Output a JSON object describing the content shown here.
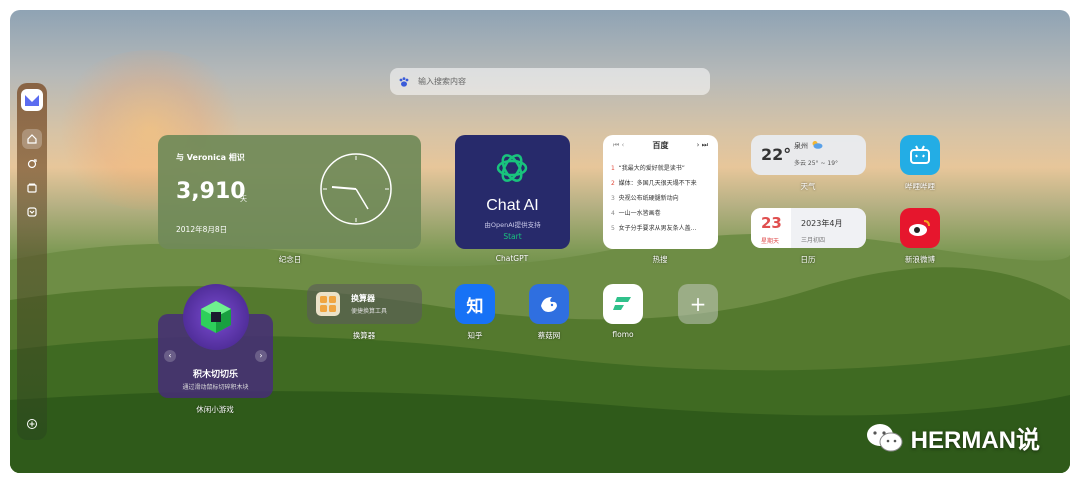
{
  "search": {
    "placeholder": "输入搜索内容"
  },
  "anniversary": {
    "title": "与 Veronica 相识",
    "days": "3,910",
    "unit": "天",
    "date": "2012年8月8日",
    "label": "纪念日"
  },
  "chatgpt": {
    "title": "Chat AI",
    "subtitle": "由OpenAI提供支持",
    "start": "Start",
    "label": "ChatGPT"
  },
  "hot": {
    "source": "百度",
    "label": "热搜",
    "items": [
      {
        "rank": "1",
        "text": "“我最大的爱好就是读书”"
      },
      {
        "rank": "2",
        "text": "媒体：多国几天很天塌不下来"
      },
      {
        "rank": "3",
        "text": "央视公布纸硬腿新动向"
      },
      {
        "rank": "4",
        "text": "一山一水皆画卷"
      },
      {
        "rank": "5",
        "text": "女子分手要求从男友条人盖..."
      }
    ]
  },
  "weather": {
    "temp": "22°",
    "city": "泉州",
    "desc": "多云 25° ~ 19°",
    "label": "天气"
  },
  "calendar": {
    "day": "23",
    "weekday": "星期天",
    "month": "2023年4月",
    "lunar": "三月初四",
    "label": "日历"
  },
  "apps": {
    "bilibili": {
      "label": "哔哩哔哩"
    },
    "weibo": {
      "label": "新浪微博"
    },
    "zhihu": {
      "label": "知乎",
      "glyph": "知"
    },
    "bird": {
      "label": "蔡菇网"
    },
    "flomo": {
      "label": "flomo"
    },
    "add": {
      "glyph": "+"
    }
  },
  "calculator": {
    "title": "换算器",
    "subtitle": "便捷换算工具",
    "label": "换算器"
  },
  "game": {
    "title": "积木切切乐",
    "subtitle": "通过滑动鼠标切碎积木块",
    "label": "休闲小游戏"
  },
  "watermark": {
    "text": "HERMAN说"
  },
  "colors": {
    "chat_green": "#19c37d",
    "weibo_red": "#e6162d",
    "bili_blue": "#23ade5",
    "zhihu_blue": "#1772f6"
  }
}
